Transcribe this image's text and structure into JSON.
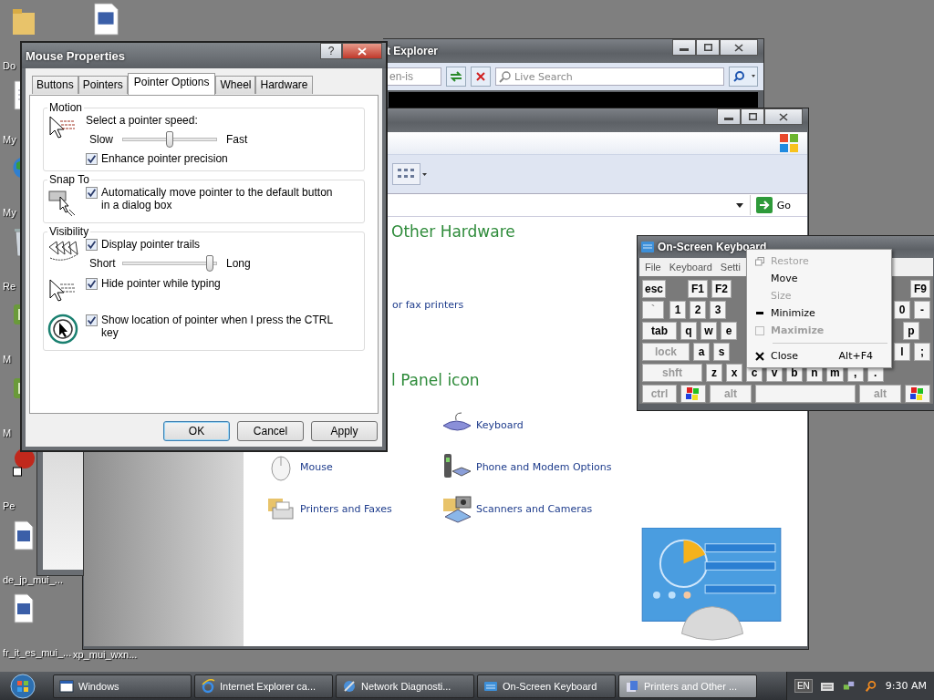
{
  "desktop_icons": [
    {
      "label": "Do",
      "kind": "folder"
    },
    {
      "label": "My",
      "kind": "document"
    },
    {
      "label": "My",
      "kind": "globe"
    },
    {
      "label": "Re",
      "kind": "bin"
    },
    {
      "label": "M",
      "kind": "app"
    },
    {
      "label": "M",
      "kind": "app"
    },
    {
      "label": "Pe",
      "kind": "ball"
    },
    {
      "label": "de_jp_mui_...",
      "kind": "file"
    },
    {
      "label": "fr_it_es_mui_...",
      "kind": "file"
    }
  ],
  "desktop_icon_extra": {
    "label": "xp_mui_wxn..."
  },
  "ie_window": {
    "title": "t Explorer",
    "address": "en-is",
    "search": {
      "placeholder": "Live Search"
    }
  },
  "control_panel": {
    "go": "Go",
    "sections": [
      {
        "kind": "heading",
        "text": "Other Hardware"
      },
      {
        "kind": "link",
        "text": "or fax printers"
      },
      {
        "kind": "heading",
        "text": "l Panel icon"
      }
    ],
    "items": [
      {
        "label": "Keyboard",
        "kind": "keyboard"
      },
      {
        "label": "Mouse",
        "kind": "mouse"
      },
      {
        "label": "Phone and Modem Options",
        "kind": "phone"
      },
      {
        "label": "Printers and Faxes",
        "kind": "printer"
      },
      {
        "label": "Scanners and Cameras",
        "kind": "scanner"
      }
    ]
  },
  "mouse_properties": {
    "title": "Mouse Properties",
    "help": "?",
    "tabs": [
      {
        "label": "Buttons",
        "selected": false
      },
      {
        "label": "Pointers",
        "selected": false
      },
      {
        "label": "Pointer Options",
        "selected": true
      },
      {
        "label": "Wheel",
        "selected": false
      },
      {
        "label": "Hardware",
        "selected": false
      }
    ],
    "groups": [
      {
        "title": "Motion",
        "items": [
          {
            "kind": "speed",
            "rows": [
              {
                "kind": "text",
                "text": "Select a pointer speed:"
              },
              {
                "kind": "slider",
                "min": "Slow",
                "max": "Fast",
                "level": 0.5
              },
              {
                "kind": "checkbox",
                "label": "Enhance pointer precision",
                "checked": true
              }
            ]
          }
        ]
      },
      {
        "title": "Snap To",
        "items": [
          {
            "kind": "snap",
            "rows": [
              {
                "kind": "checkbox",
                "label": "Automatically move pointer to the default button in a dialog box",
                "checked": true
              }
            ]
          }
        ]
      },
      {
        "title": "Visibility",
        "items": [
          {
            "kind": "trails",
            "rows": [
              {
                "kind": "checkbox",
                "label": "Display pointer trails",
                "checked": true
              },
              {
                "kind": "slider",
                "min": "Short",
                "max": "Long",
                "level": 0.96
              }
            ]
          },
          {
            "kind": "hide",
            "rows": [
              {
                "kind": "checkbox",
                "label": "Hide pointer while typing",
                "checked": true
              }
            ]
          },
          {
            "kind": "locate",
            "rows": [
              {
                "kind": "checkbox",
                "label": "Show location of pointer when I press the CTRL key",
                "checked": true
              }
            ]
          }
        ]
      }
    ],
    "buttons": [
      {
        "label": "OK",
        "default": true
      },
      {
        "label": "Cancel",
        "default": false
      },
      {
        "label": "Apply",
        "default": false
      }
    ]
  },
  "keyboard_window": {
    "title": "On-Screen Keyboard",
    "menu": [
      "File",
      "Keyboard",
      "Setti"
    ],
    "rows": [
      {
        "left": [
          {
            "label": "esc",
            "kind": "key"
          },
          {
            "label": "F1",
            "kind": "key"
          },
          {
            "label": "F2",
            "kind": "key"
          }
        ],
        "right": [
          {
            "label": "F9",
            "kind": "key"
          }
        ]
      },
      {
        "left": [
          {
            "label": "`",
            "kind": "dim"
          },
          {
            "label": "1",
            "kind": "key"
          },
          {
            "label": "2",
            "kind": "key"
          },
          {
            "label": "3",
            "kind": "key"
          }
        ],
        "right": [
          {
            "label": "0",
            "kind": "key"
          },
          {
            "label": "-",
            "kind": "key"
          }
        ]
      },
      {
        "left": [
          {
            "label": "tab",
            "kind": "key"
          },
          {
            "label": "q",
            "kind": "key"
          },
          {
            "label": "w",
            "kind": "key"
          },
          {
            "label": "e",
            "kind": "key"
          }
        ],
        "right": [
          {
            "label": "p",
            "kind": "key"
          }
        ]
      },
      {
        "left": [
          {
            "label": "lock",
            "kind": "dim"
          },
          {
            "label": "a",
            "kind": "key"
          },
          {
            "label": "s",
            "kind": "key"
          }
        ],
        "right": [
          {
            "label": "l",
            "kind": "key"
          },
          {
            "label": ";",
            "kind": "key"
          }
        ]
      },
      {
        "left": [
          {
            "label": "shft",
            "kind": "dim"
          },
          {
            "label": "z",
            "kind": "key"
          },
          {
            "label": "x",
            "kind": "key"
          },
          {
            "label": "c",
            "kind": "key"
          },
          {
            "label": "v",
            "kind": "key"
          },
          {
            "label": "b",
            "kind": "key"
          },
          {
            "label": "n",
            "kind": "key"
          },
          {
            "label": "m",
            "kind": "key"
          },
          {
            "label": ",",
            "kind": "key"
          },
          {
            "label": ".",
            "kind": "key"
          }
        ],
        "right": []
      },
      {
        "left": [
          {
            "label": "ctrl",
            "kind": "dim"
          },
          {
            "kind": "win"
          },
          {
            "label": "alt",
            "kind": "dim"
          },
          {
            "kind": "space"
          },
          {
            "label": "alt",
            "kind": "dim"
          },
          {
            "kind": "win"
          }
        ],
        "right": []
      }
    ]
  },
  "context_menu": {
    "items": [
      {
        "kind": "restore",
        "label": "Restore",
        "disabled": true,
        "default": false
      },
      {
        "kind": "plain",
        "label": "Move",
        "disabled": false,
        "default": false
      },
      {
        "kind": "plain",
        "label": "Size",
        "disabled": true,
        "default": false
      },
      {
        "kind": "minimize",
        "label": "Minimize",
        "disabled": false,
        "default": false
      },
      {
        "kind": "maximize",
        "label": "Maximize",
        "disabled": true,
        "default": true
      },
      {
        "kind": "separator"
      },
      {
        "kind": "close",
        "label": "Close",
        "shortcut": "Alt+F4",
        "disabled": false,
        "default": false
      }
    ]
  },
  "taskbar": {
    "items": [
      {
        "label": "Windows",
        "kind": "window",
        "selected": false
      },
      {
        "label": "Internet Explorer ca...",
        "kind": "ie",
        "selected": false
      },
      {
        "label": "Network Diagnosti...",
        "kind": "network",
        "selected": false
      },
      {
        "label": "On-Screen Keyboard",
        "kind": "keyboard",
        "selected": false
      },
      {
        "label": "Printers and Other ...",
        "kind": "folder",
        "selected": true
      }
    ],
    "language": "EN",
    "clock": "9:30 AM"
  }
}
